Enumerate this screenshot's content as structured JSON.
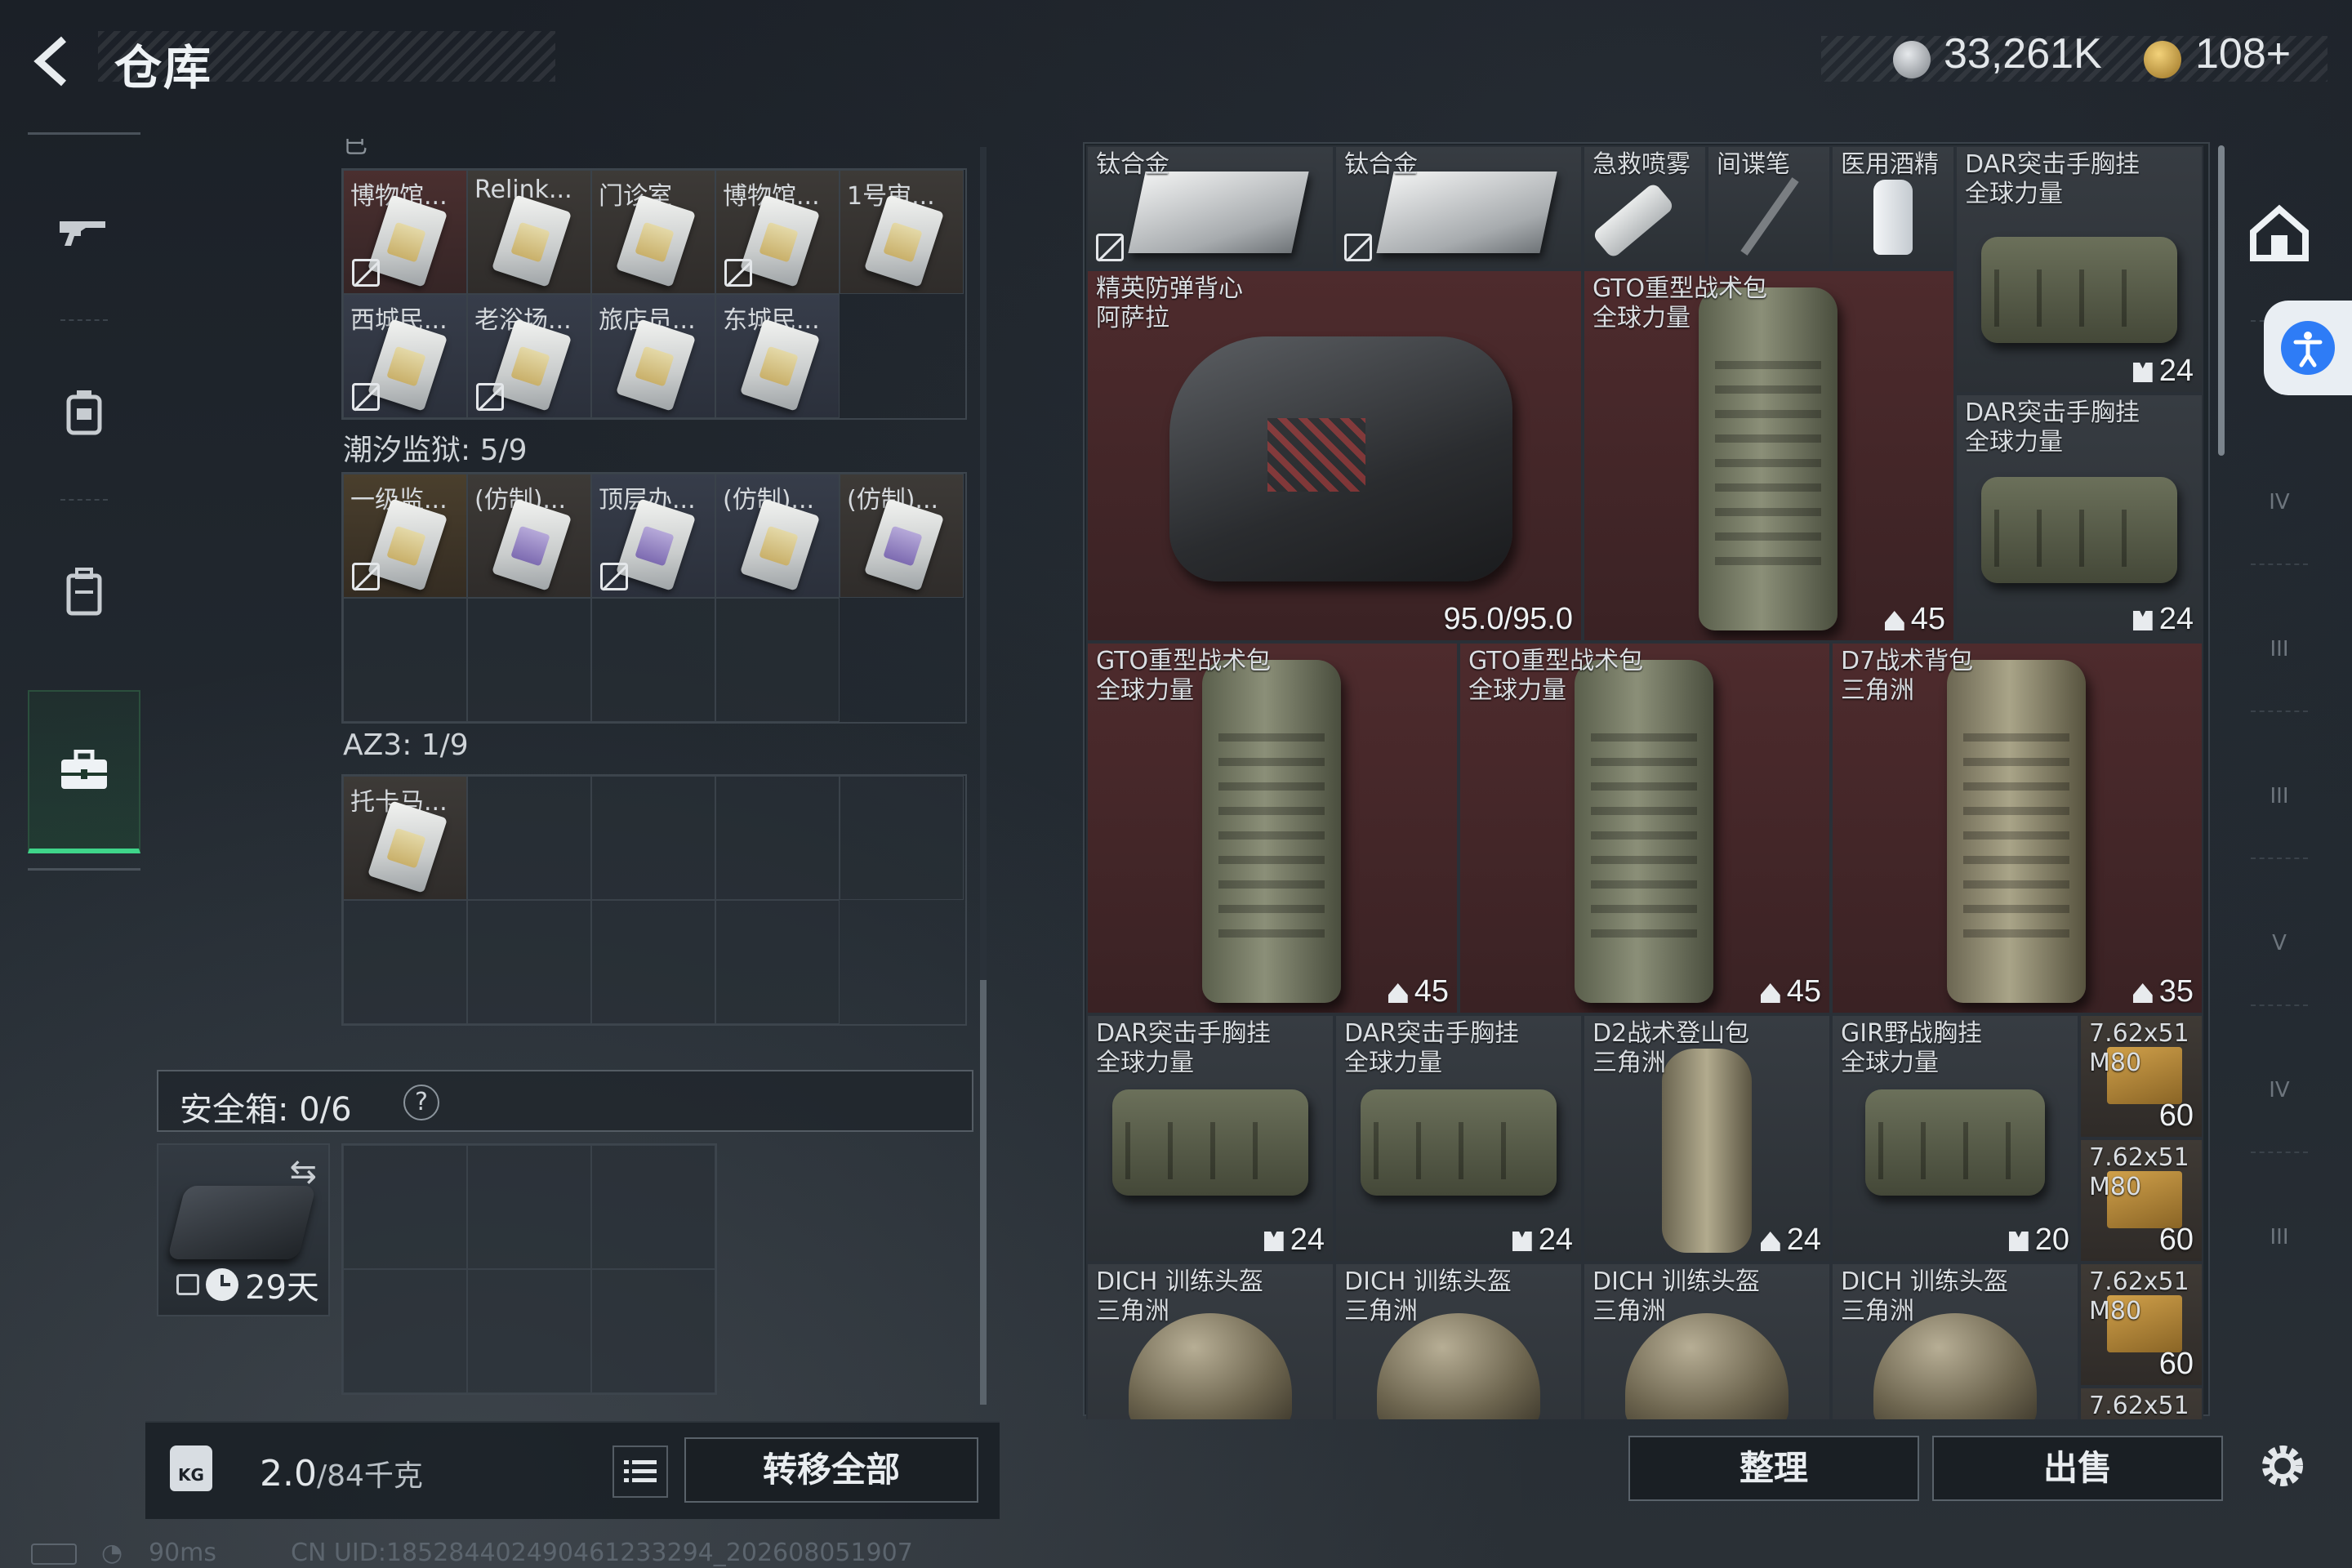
{
  "header": {
    "title": "仓库",
    "currency": {
      "silver": "33,261K",
      "gold": "108+"
    }
  },
  "left_nav": [
    "gun-icon",
    "armor-icon",
    "backpack-icon",
    "toolbox-icon"
  ],
  "player_bag": {
    "partial_section_label": "已",
    "keycards_row1": [
      "博物馆...",
      "Relink...",
      "门诊室",
      "博物馆...",
      "1号审..."
    ],
    "keycards_row2": [
      "西城民...",
      "老浴场...",
      "旅店员...",
      "东城民..."
    ],
    "section_tide": "潮汐监狱: 5/9",
    "tide_row": [
      "一级监...",
      "(仿制)...",
      "顶层办...",
      "(仿制)...",
      "(仿制)..."
    ],
    "section_az3": "AZ3: 1/9",
    "az3_row": [
      "托卡马..."
    ],
    "safe_label": "安全箱: 0/6",
    "safe_help": "?",
    "safe_days": "29天",
    "weight": "2.0",
    "weight_max": "/84千克",
    "transfer_all": "转移全部"
  },
  "storage": {
    "items": [
      {
        "name": "钛合金",
        "sub": "",
        "count": ""
      },
      {
        "name": "钛合金",
        "sub": "",
        "count": ""
      },
      {
        "name": "急救喷雾",
        "sub": "",
        "count": ""
      },
      {
        "name": "间谍笔",
        "sub": "",
        "count": ""
      },
      {
        "name": "医用酒精",
        "sub": "",
        "count": ""
      },
      {
        "name": "DAR突击手胸挂",
        "sub": "全球力量",
        "count": "24"
      },
      {
        "name": "精英防弹背心",
        "sub": "阿萨拉",
        "count": "95.0/95.0"
      },
      {
        "name": "GTO重型战术包",
        "sub": "全球力量",
        "count": "45"
      },
      {
        "name": "DAR突击手胸挂",
        "sub": "全球力量",
        "count": "24"
      },
      {
        "name": "GTO重型战术包",
        "sub": "全球力量",
        "count": "45"
      },
      {
        "name": "GTO重型战术包",
        "sub": "全球力量",
        "count": "45"
      },
      {
        "name": "D7战术背包",
        "sub": "三角洲",
        "count": "35"
      },
      {
        "name": "DAR突击手胸挂",
        "sub": "全球力量",
        "count": "24"
      },
      {
        "name": "DAR突击手胸挂",
        "sub": "全球力量",
        "count": "24"
      },
      {
        "name": "D2战术登山包",
        "sub": "三角洲",
        "count": "24"
      },
      {
        "name": "GIR野战胸挂",
        "sub": "全球力量",
        "count": "20"
      },
      {
        "name": "7.62x51",
        "sub": "M80",
        "count": "60"
      },
      {
        "name": "7.62x51",
        "sub": "M80",
        "count": "60"
      },
      {
        "name": "DICH 训练头盔",
        "sub": "三角洲",
        "count": ""
      },
      {
        "name": "DICH 训练头盔",
        "sub": "三角洲",
        "count": ""
      },
      {
        "name": "DICH 训练头盔",
        "sub": "三角洲",
        "count": ""
      },
      {
        "name": "DICH 训练头盔",
        "sub": "三角洲",
        "count": ""
      },
      {
        "name": "7.62x51",
        "sub": "M80",
        "count": "60"
      },
      {
        "name": "7.62x51",
        "sub": "",
        "count": ""
      }
    ],
    "sort_label": "整理",
    "sell_label": "出售"
  },
  "right_rail": [
    "home-icon",
    "IV",
    "IV",
    "III",
    "III",
    "V",
    "IV",
    "III"
  ],
  "status": {
    "ping": "90ms",
    "uid": "CN UID:1852844024904612332​94_202608051907"
  },
  "colors": {
    "accent": "#3fd58a",
    "item_red": "#4e2b2d",
    "access_blue": "#2e7cf6"
  }
}
